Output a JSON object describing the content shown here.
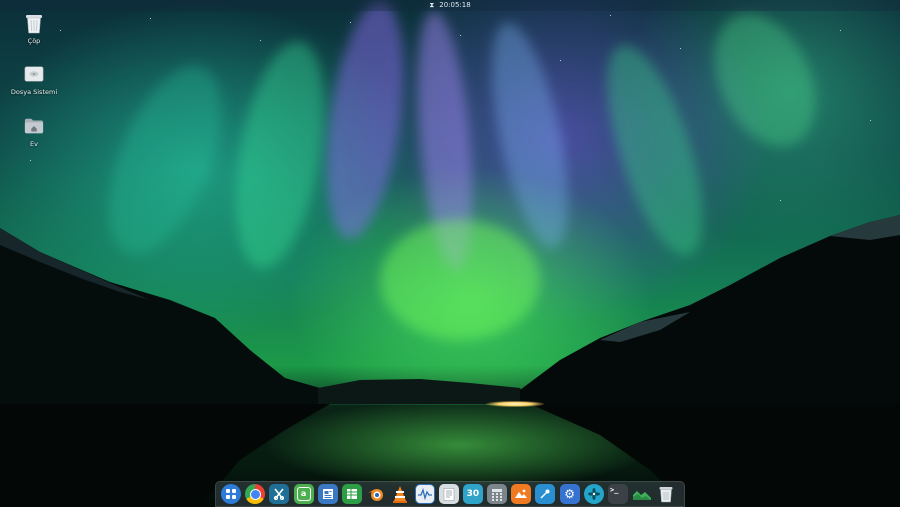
{
  "top_panel": {
    "time": "20:05:18"
  },
  "desktop_icons": [
    {
      "label": "Çöp",
      "icon": "trash-icon"
    },
    {
      "label": "Dosya Sistemi",
      "icon": "drive-icon"
    },
    {
      "label": "Ev",
      "icon": "home-folder-icon"
    }
  ],
  "dock": {
    "apps": [
      {
        "icon": "launcher-icon",
        "color": "#2f7bd8"
      },
      {
        "icon": "chrome-icon",
        "color": "#4285f4"
      },
      {
        "icon": "screenshot-icon",
        "color": "#3aa0c8"
      },
      {
        "icon": "app-store-icon",
        "color": "#4cb050"
      },
      {
        "icon": "writer-icon",
        "color": "#3b78c4"
      },
      {
        "icon": "spreadsheet-icon",
        "color": "#2e9e46"
      },
      {
        "icon": "blender-icon",
        "color": "#f08a24"
      },
      {
        "icon": "vlc-icon",
        "color": "#f5861f"
      },
      {
        "icon": "system-monitor-icon",
        "color": "#2f6fb8"
      },
      {
        "icon": "text-editor-icon",
        "color": "#d8dde2"
      },
      {
        "icon": "calendar-icon",
        "color": "#2fa3c8",
        "text": "30"
      },
      {
        "icon": "calculator-icon",
        "color": "#7c858c"
      },
      {
        "icon": "image-viewer-icon",
        "color": "#f07a22"
      },
      {
        "icon": "color-picker-icon",
        "color": "#2a8fd0"
      },
      {
        "icon": "settings-icon",
        "color": "#3672d0"
      },
      {
        "icon": "fan-icon",
        "color": "#23a6c9"
      },
      {
        "icon": "terminal-icon",
        "color": "#3b4147",
        "text": ">_"
      },
      {
        "icon": "cloud-icon",
        "color": "#3b8a4a"
      },
      {
        "icon": "trash-icon",
        "color": "#cfd6da"
      }
    ]
  }
}
